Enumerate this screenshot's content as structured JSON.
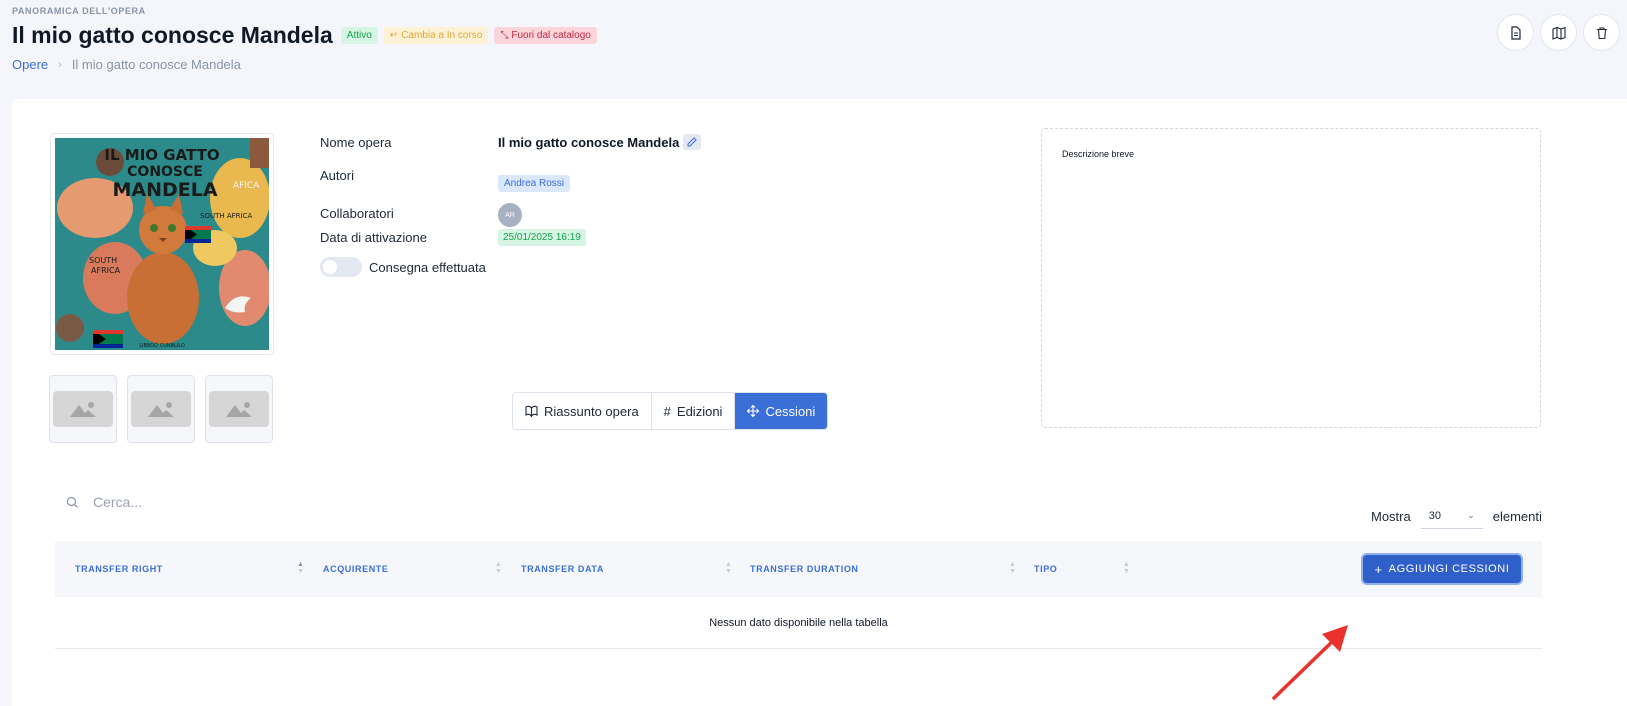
{
  "header": {
    "overline": "PANORAMICA DELL'OPERA",
    "title": "Il mio gatto conosce Mandela",
    "badges": {
      "active": "Attivo",
      "change": "Cambia a In corso",
      "out": "Fuori dal catalogo"
    },
    "breadcrumb": {
      "root": "Opere",
      "current": "Il mio gatto conosce Mandela"
    }
  },
  "cover": {
    "line1": "IL MIO GATTO",
    "line2": "CONOSCE",
    "line3": "MANDELA",
    "label_south_africa": "SOUTH AFRICA",
    "label_south": "SOUTH",
    "label_africa": "AFRICA",
    "label_afica": "AFICA",
    "label_footer": "LIBBOO CUNBLILO"
  },
  "info": {
    "name_label": "Nome opera",
    "name_value": "Il mio gatto conosce Mandela",
    "authors_label": "Autori",
    "author": "Andrea Rossi",
    "collaborators_label": "Collaboratori",
    "collaborator_initials": "AR",
    "activation_label": "Data di attivazione",
    "activation_date": "25/01/2025 16:19",
    "delivery_label": "Consegna effettuata"
  },
  "description": {
    "label": "Descrizione breve"
  },
  "tabs": {
    "summary": "Riassunto opera",
    "editions": "Edizioni",
    "cessions": "Cessioni"
  },
  "table": {
    "search_placeholder": "Cerca...",
    "show_label": "Mostra",
    "page_size": "30",
    "elements_label": "elementi",
    "columns": [
      "TRANSFER RIGHT",
      "ACQUIRENTE",
      "TRANSFER DATA",
      "TRANSFER DURATION",
      "TIPO"
    ],
    "add_button": "AGGIUNGI CESSIONI",
    "empty_text": "Nessun dato disponibile nella tabella"
  },
  "colors": {
    "primary": "#3b6fd8",
    "annotation_arrow": "#e8322b"
  }
}
